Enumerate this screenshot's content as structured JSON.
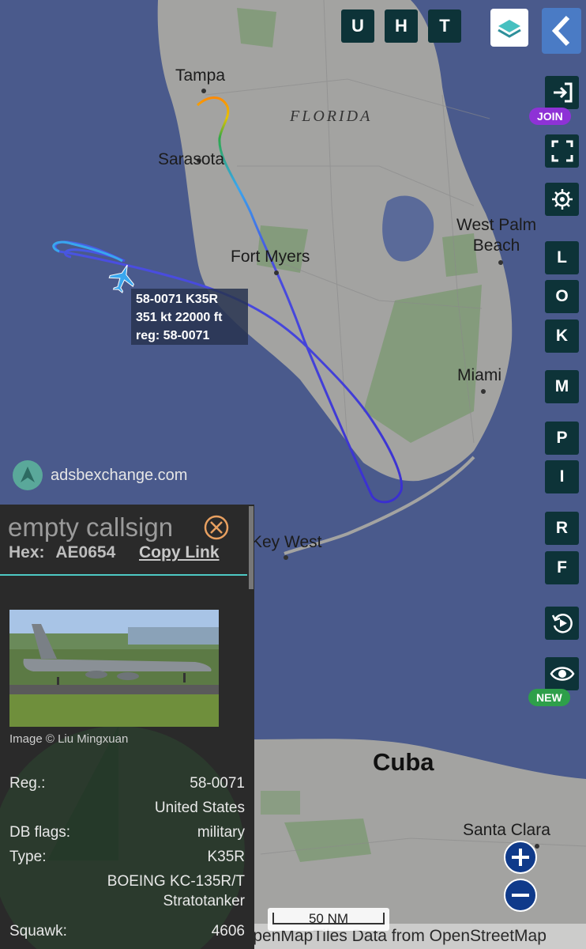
{
  "map": {
    "cities": [
      {
        "id": "tampa",
        "name": "Tampa"
      },
      {
        "id": "sarasota",
        "name": "Sarasota"
      },
      {
        "id": "fort-myers",
        "name": "Fort Myers"
      },
      {
        "id": "west-palm-beach",
        "name": "West Palm\nBeach"
      },
      {
        "id": "miami",
        "name": "Miami"
      },
      {
        "id": "key-west",
        "name": "Key West"
      },
      {
        "id": "santa-clara",
        "name": "Santa Clara"
      }
    ],
    "state_label": "FLORIDA",
    "country_label": "Cuba",
    "attribution": "OpenMapTiles Data from OpenStreetMap",
    "scale_label": "50 NM"
  },
  "aircraft_label": {
    "line1": "58-0071 K35R",
    "line2": "351 kt  22000 ft",
    "line3": "reg: 58-0071"
  },
  "logo": {
    "text": "adsbexchange.com"
  },
  "top_buttons": [
    "U",
    "H",
    "T"
  ],
  "side_buttons": {
    "join_badge": "JOIN",
    "new_badge": "NEW",
    "letters": [
      "L",
      "O",
      "K",
      "M",
      "P",
      "I",
      "R",
      "F"
    ]
  },
  "panel": {
    "callsign": "empty callsign",
    "hex_label": "Hex:",
    "hex_value": "AE0654",
    "copy_link": "Copy Link",
    "image_credit": "Image © Liu Mingxuan",
    "rows": {
      "reg_label": "Reg.:",
      "reg_value": "58-0071",
      "country_value": "United States",
      "dbflags_label": "DB flags:",
      "dbflags_value": "military",
      "type_label": "Type:",
      "type_value": "K35R",
      "type_desc_1": "BOEING KC-135R/T",
      "type_desc_2": "Stratotanker",
      "squawk_label": "Squawk:",
      "squawk_value": "4606"
    }
  },
  "colors": {
    "ocean": "#4a5a8c",
    "land": "#a3a3a1",
    "park": "#7f9a76",
    "lake": "#5a6a99",
    "track_low": "#3a2fd0",
    "track_mid": "#39a6ee",
    "track_high": "#2ea84a",
    "track_climb": "#ff8a00",
    "panel_accent": "#4ec9c4",
    "join_badge": "#8e32d6",
    "new_badge": "#2e9f4a",
    "button_bg": "#0d3338"
  },
  "icons": [
    "layers-icon",
    "back-chevron-icon",
    "login-arrow-icon",
    "fullscreen-icon",
    "gear-icon",
    "replay-icon",
    "eye-icon",
    "close-circle-icon",
    "plane-icon",
    "zoom-in-icon",
    "zoom-out-icon"
  ]
}
